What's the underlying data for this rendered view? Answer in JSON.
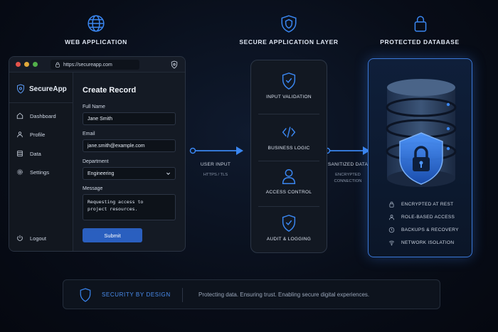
{
  "columns": {
    "web": "WEB APPLICATION",
    "secure": "SECURE APPLICATION LAYER",
    "db": "PROTECTED DATABASE"
  },
  "browser": {
    "url": "https://secureapp.com",
    "brand": "SecureApp",
    "nav": [
      "Dashboard",
      "Profile",
      "Data",
      "Settings"
    ],
    "logout": "Logout",
    "form": {
      "title": "Create Record",
      "full_name_label": "Full Name",
      "full_name_value": "Jane Smith",
      "email_label": "Email",
      "email_value": "jane.smith@example.com",
      "department_label": "Department",
      "department_value": "Engineering",
      "message_label": "Message",
      "message_line1": "Requesting access to",
      "message_line2": "project resources.",
      "submit": "Submit"
    }
  },
  "flow": {
    "left_label": "USER INPUT",
    "left_sub": "HTTPS / TLS",
    "right_label": "SANITIZED DATA",
    "right_sub1": "ENCRYPTED",
    "right_sub2": "CONNECTION"
  },
  "layer": {
    "items": [
      "INPUT VALIDATION",
      "BUSINESS LOGIC",
      "ACCESS CONTROL",
      "AUDIT & LOGGING"
    ]
  },
  "database": {
    "features": [
      "ENCRYPTED AT REST",
      "ROLE-BASED ACCESS",
      "BACKUPS & RECOVERY",
      "NETWORK ISOLATION"
    ]
  },
  "footer": {
    "title": "SECURITY BY DESIGN",
    "tagline": "Protecting data. Ensuring trust. Enabling secure digital experiences."
  },
  "colors": {
    "accent": "#3a86f0",
    "accent_dark": "#2a5fbf",
    "panel": "#141a24",
    "background": "#080d18"
  }
}
